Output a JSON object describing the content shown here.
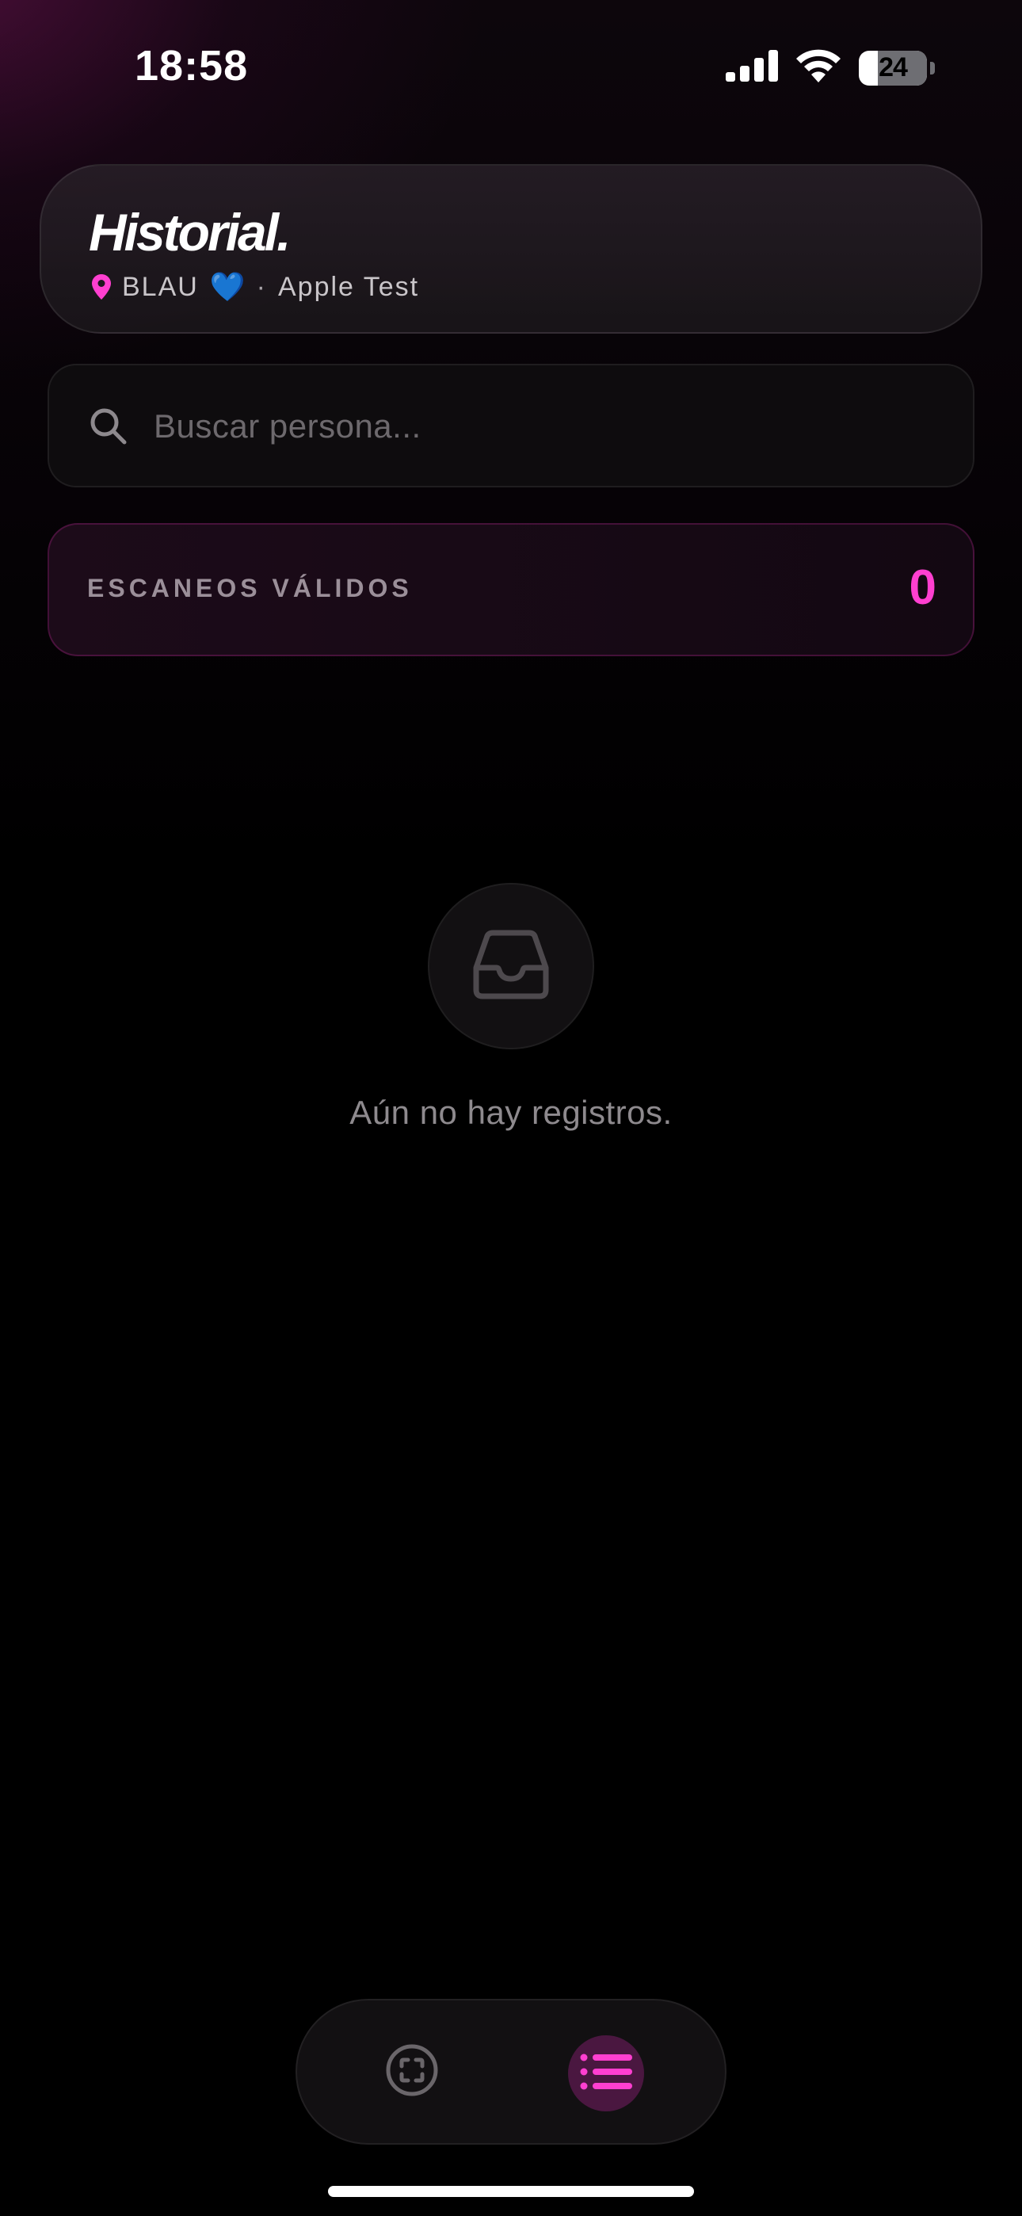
{
  "status_bar": {
    "time": "18:58",
    "battery_level": "24",
    "icons": [
      "cellular-signal-icon",
      "wifi-icon",
      "battery-icon"
    ]
  },
  "header": {
    "title": "Historial.",
    "venue": "BLAU",
    "venue_emoji": "💙",
    "separator": "·",
    "event": "Apple Test",
    "location_icon": "location-pin-icon"
  },
  "search": {
    "placeholder": "Buscar persona...",
    "value": "",
    "icon": "search-icon"
  },
  "stats": {
    "label": "ESCANEOS VÁLIDOS",
    "value": "0"
  },
  "empty_state": {
    "icon": "inbox-tray-icon",
    "message": "Aún no hay registros."
  },
  "nav": {
    "items": [
      {
        "id": "scan",
        "icon": "scan-frame-icon",
        "active": false
      },
      {
        "id": "history",
        "icon": "list-icon",
        "active": true
      }
    ]
  },
  "colors": {
    "accent": "#ff3fd0",
    "background": "#000000",
    "card": "#1a161a",
    "nav_active_bg": "#4a1740",
    "heart": "#3aa0ff"
  }
}
